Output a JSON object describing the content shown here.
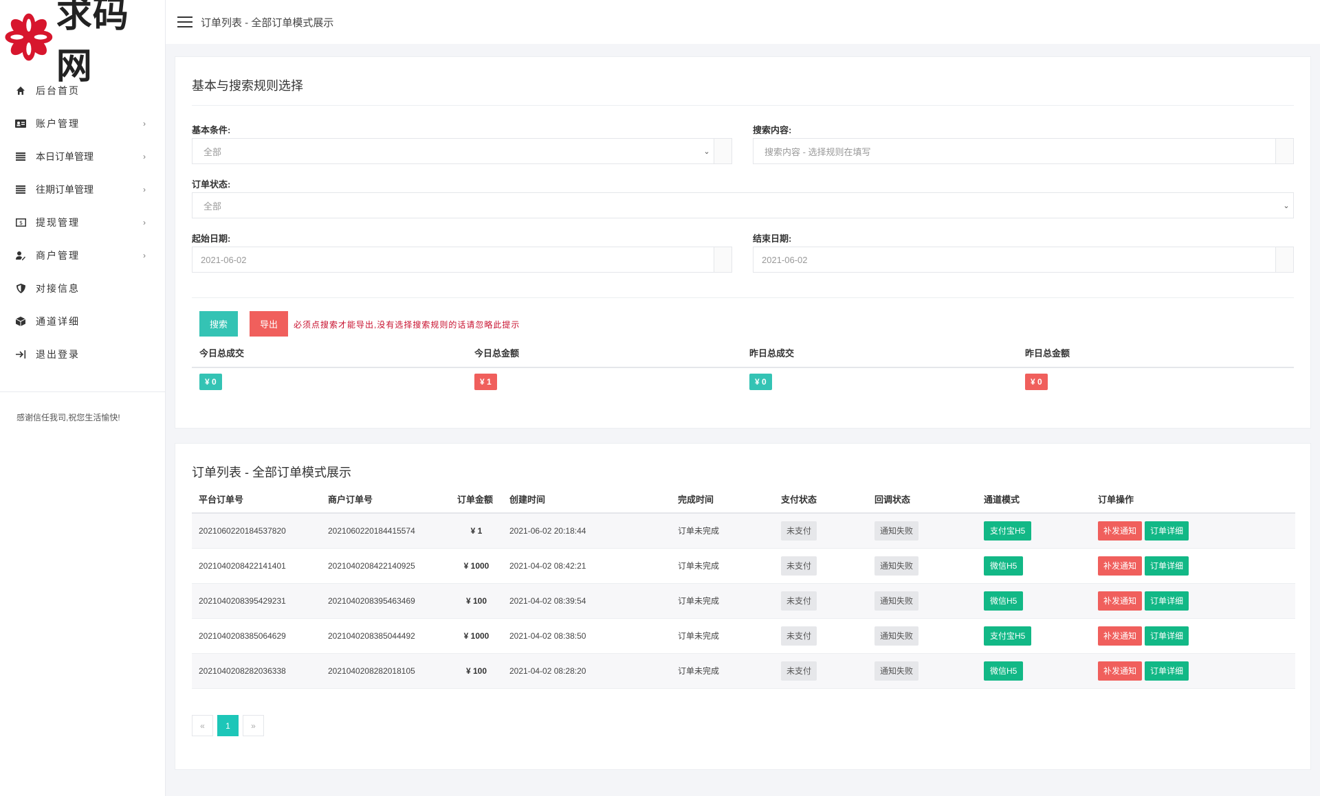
{
  "brand": {
    "logo_text": "求码网"
  },
  "sidebar": {
    "items": [
      {
        "label": "后台首页",
        "icon": "home-icon",
        "has_children": false
      },
      {
        "label": "账户管理",
        "icon": "id-card-icon",
        "has_children": true
      },
      {
        "label": "本日订单管理",
        "icon": "list-icon",
        "has_children": true
      },
      {
        "label": "往期订单管理",
        "icon": "list-icon",
        "has_children": true
      },
      {
        "label": "提现管理",
        "icon": "money-icon",
        "has_children": true
      },
      {
        "label": "商户管理",
        "icon": "user-edit-icon",
        "has_children": true
      },
      {
        "label": "对接信息",
        "icon": "shield-icon",
        "has_children": false
      },
      {
        "label": "通道详细",
        "icon": "cube-icon",
        "has_children": false
      },
      {
        "label": "退出登录",
        "icon": "logout-icon",
        "has_children": false
      }
    ],
    "chevron": "›",
    "footer": "感谢信任我司,祝您生活愉快!"
  },
  "topbar": {
    "title": "订单列表 - 全部订单模式展示"
  },
  "search": {
    "title": "基本与搜索规则选择",
    "basic_label": "基本条件:",
    "basic_value": "全部",
    "content_label": "搜索内容:",
    "content_placeholder": "搜索内容 - 选择规则在填写",
    "status_label": "订单状态:",
    "status_value": "全部",
    "start_label": "起始日期:",
    "start_value": "2021-06-02",
    "end_label": "结束日期:",
    "end_value": "2021-06-02",
    "search_button": "搜索",
    "export_button": "导出",
    "hint": "必须点搜索才能导出,没有选择搜索规则的话请忽略此提示"
  },
  "stats": [
    {
      "label": "今日总成交",
      "value": "¥ 0",
      "color": "#34c3b4"
    },
    {
      "label": "今日总金额",
      "value": "¥ 1",
      "color": "#f05f5c"
    },
    {
      "label": "昨日总成交",
      "value": "¥ 0",
      "color": "#34c3b4"
    },
    {
      "label": "昨日总金额",
      "value": "¥ 0",
      "color": "#f05f5c"
    }
  ],
  "orders": {
    "title": "订单列表 - 全部订单模式展示",
    "columns": [
      "平台订单号",
      "商户订单号",
      "订单金额",
      "创建时间",
      "完成时间",
      "支付状态",
      "回调状态",
      "通道模式",
      "订单操作"
    ],
    "rows": [
      {
        "platform_no": "2021060220184537820",
        "merchant_no": "2021060220184415574",
        "amount": "¥ 1",
        "created": "2021-06-02 20:18:44",
        "finished": "订单未完成",
        "pay_status": "未支付",
        "callback": "通知失败",
        "channel": "支付宝H5"
      },
      {
        "platform_no": "2021040208422141401",
        "merchant_no": "2021040208422140925",
        "amount": "¥ 1000",
        "created": "2021-04-02 08:42:21",
        "finished": "订单未完成",
        "pay_status": "未支付",
        "callback": "通知失败",
        "channel": "微信H5"
      },
      {
        "platform_no": "2021040208395429231",
        "merchant_no": "2021040208395463469",
        "amount": "¥ 100",
        "created": "2021-04-02 08:39:54",
        "finished": "订单未完成",
        "pay_status": "未支付",
        "callback": "通知失败",
        "channel": "微信H5"
      },
      {
        "platform_no": "2021040208385064629",
        "merchant_no": "2021040208385044492",
        "amount": "¥ 1000",
        "created": "2021-04-02 08:38:50",
        "finished": "订单未完成",
        "pay_status": "未支付",
        "callback": "通知失败",
        "channel": "支付宝H5"
      },
      {
        "platform_no": "2021040208282036338",
        "merchant_no": "2021040208282018105",
        "amount": "¥ 100",
        "created": "2021-04-02 08:28:20",
        "finished": "订单未完成",
        "pay_status": "未支付",
        "callback": "通知失败",
        "channel": "微信H5"
      }
    ],
    "op_resend": "补发通知",
    "op_detail": "订单详细"
  },
  "pagination": {
    "prev": "«",
    "current": "1",
    "next": "»"
  },
  "colors": {
    "teal": "#34c3b4",
    "red": "#f05f5c",
    "green": "#12b886",
    "brand_red": "#d7162d"
  }
}
